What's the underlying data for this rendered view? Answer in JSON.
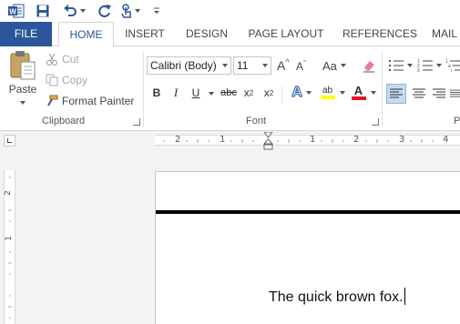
{
  "quick_access": {
    "word_icon": "W",
    "save_icon": "save-icon",
    "undo_icon": "undo-icon",
    "redo_icon": "redo-icon",
    "touch_icon": "touch-mode-icon",
    "customize_icon": "customize-qat-icon"
  },
  "tabs": {
    "file": "FILE",
    "home": "HOME",
    "insert": "INSERT",
    "design": "DESIGN",
    "page_layout": "PAGE LAYOUT",
    "references": "REFERENCES",
    "mailings": "MAIL"
  },
  "clipboard": {
    "paste": "Paste",
    "cut": "Cut",
    "copy": "Copy",
    "format_painter": "Format Painter",
    "group_label": "Clipboard"
  },
  "font": {
    "font_name": "Calibri (Body)",
    "font_size": "11",
    "change_case": "Aa",
    "bold": "B",
    "italic": "I",
    "underline": "U",
    "strikethrough": "abc",
    "subscript_base": "x",
    "subscript_mark": "2",
    "superscript_base": "x",
    "superscript_mark": "2",
    "text_effects": "A",
    "highlight": "ab",
    "font_color": "A",
    "grow": "A",
    "shrink": "A",
    "group_label": "Font"
  },
  "paragraph": {
    "group_label": "P"
  },
  "ruler": {
    "marks": [
      "2",
      "1",
      "1",
      "2",
      "3",
      "4"
    ]
  },
  "vruler": {
    "marks": [
      "2",
      "1"
    ]
  },
  "document": {
    "text": "The quick brown fox."
  },
  "colors": {
    "word_blue": "#2b579a",
    "highlight_yellow": "#ffff00",
    "font_red": "#e81123"
  }
}
